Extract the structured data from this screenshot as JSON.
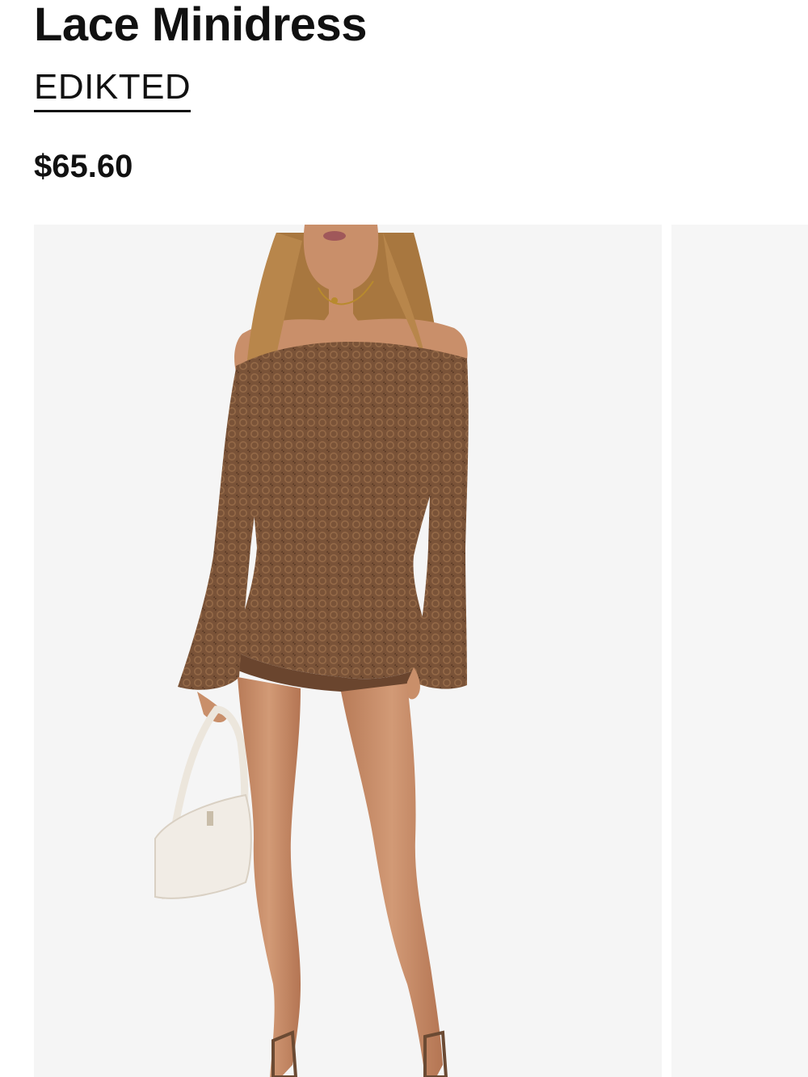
{
  "product": {
    "title": "Lace Minidress",
    "brand": "EDIKTED",
    "price": "$65.60"
  },
  "gallery": {
    "images": [
      {
        "subject": "model-wearing-brown-lace-off-shoulder-minidress"
      },
      {
        "subject": "next-product-image-partial"
      }
    ]
  },
  "colors": {
    "text": "#111111",
    "image_background": "#f5f5f5",
    "dress": "#7a5338",
    "skin": "#c98f6a",
    "hair": "#a8773f",
    "bag": "#f1ece5"
  }
}
